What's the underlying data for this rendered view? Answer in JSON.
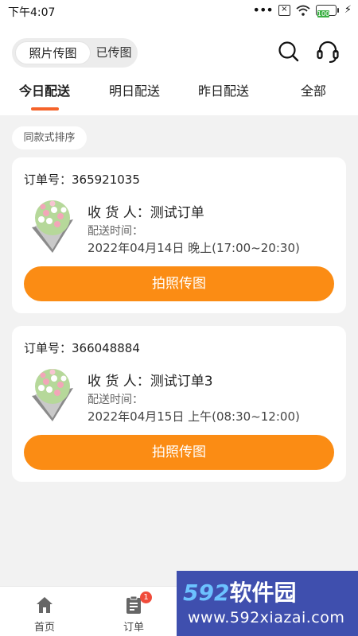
{
  "status_bar": {
    "time": "下午4:07",
    "battery": "100",
    "sim_label": "×"
  },
  "header": {
    "toggle": {
      "active": "照片传图",
      "inactive": "已传图"
    }
  },
  "tabs": [
    {
      "label": "今日配送",
      "active": true
    },
    {
      "label": "明日配送",
      "active": false
    },
    {
      "label": "昨日配送",
      "active": false
    },
    {
      "label": "全部",
      "active": false
    }
  ],
  "filter_chip": "同款式排序",
  "orders": [
    {
      "order_no": "订单号：365921035",
      "recipient": "收 货 人：测试订单",
      "time_label": "配送时间：",
      "time_value": "2022年04月14日 晚上(17:00~20:30)",
      "action": "拍照传图"
    },
    {
      "order_no": "订单号：366048884",
      "recipient": "收 货 人：测试订单3",
      "time_label": "配送时间：",
      "time_value": "2022年04月15日 上午(08:30~12:00)",
      "action": "拍照传图"
    }
  ],
  "bottom_nav": {
    "home": "首页",
    "orders": "订单",
    "orders_badge": "1"
  },
  "watermark": {
    "digits": "592",
    "brand": "软件园",
    "url": "www.592xiazai.com"
  },
  "colors": {
    "accent": "#fb8c14",
    "tab_indicator": "#f5632a",
    "badge": "#f04b3a"
  },
  "icons": [
    "search-icon",
    "headset-icon",
    "home-icon",
    "clipboard-icon",
    "wifi-icon",
    "battery-icon"
  ]
}
